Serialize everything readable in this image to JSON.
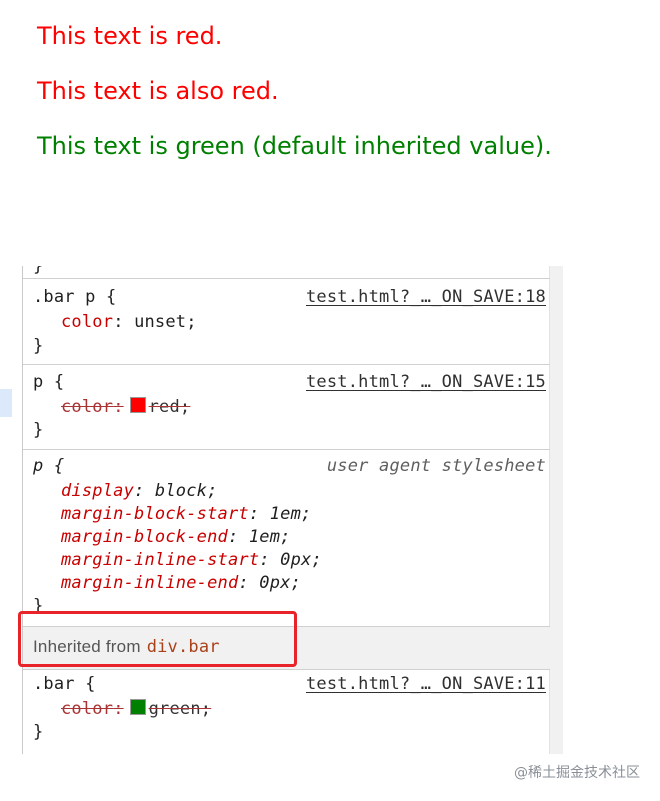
{
  "preview": {
    "line1": "This text is red.",
    "line2": "This text is also red.",
    "line3": "This text is green (default inherited value).",
    "red_color": "#ff0000",
    "green_color": "#008000"
  },
  "styles_panel": {
    "top_brace": "}",
    "rule_bar_p": {
      "selector": ".bar p {",
      "source": "test.html?_…_ON_SAVE:18",
      "prop": "color",
      "value": "unset;",
      "close": "}"
    },
    "rule_p": {
      "selector": "p {",
      "source": "test.html?_…_ON_SAVE:15",
      "prop": "color",
      "value": "red;",
      "swatch_color": "#ff0000",
      "close": "}"
    },
    "rule_ua": {
      "selector": "p {",
      "source": "user agent stylesheet",
      "decls": [
        {
          "prop": "display",
          "value": "block;"
        },
        {
          "prop": "margin-block-start",
          "value": "1em;"
        },
        {
          "prop": "margin-block-end",
          "value": "1em;"
        },
        {
          "prop": "margin-inline-start",
          "value": "0px;"
        },
        {
          "prop": "margin-inline-end",
          "value": "0px;"
        }
      ],
      "close": "}"
    },
    "inherited": {
      "label": "Inherited from",
      "node": "div.bar"
    },
    "rule_bar": {
      "selector": ".bar {",
      "source": "test.html?_…_ON_SAVE:11",
      "prop": "color",
      "value": "green;",
      "swatch_color": "#008000",
      "close": "}"
    }
  },
  "watermark": "@稀土掘金技术社区",
  "highlight_color": "#e8232a"
}
